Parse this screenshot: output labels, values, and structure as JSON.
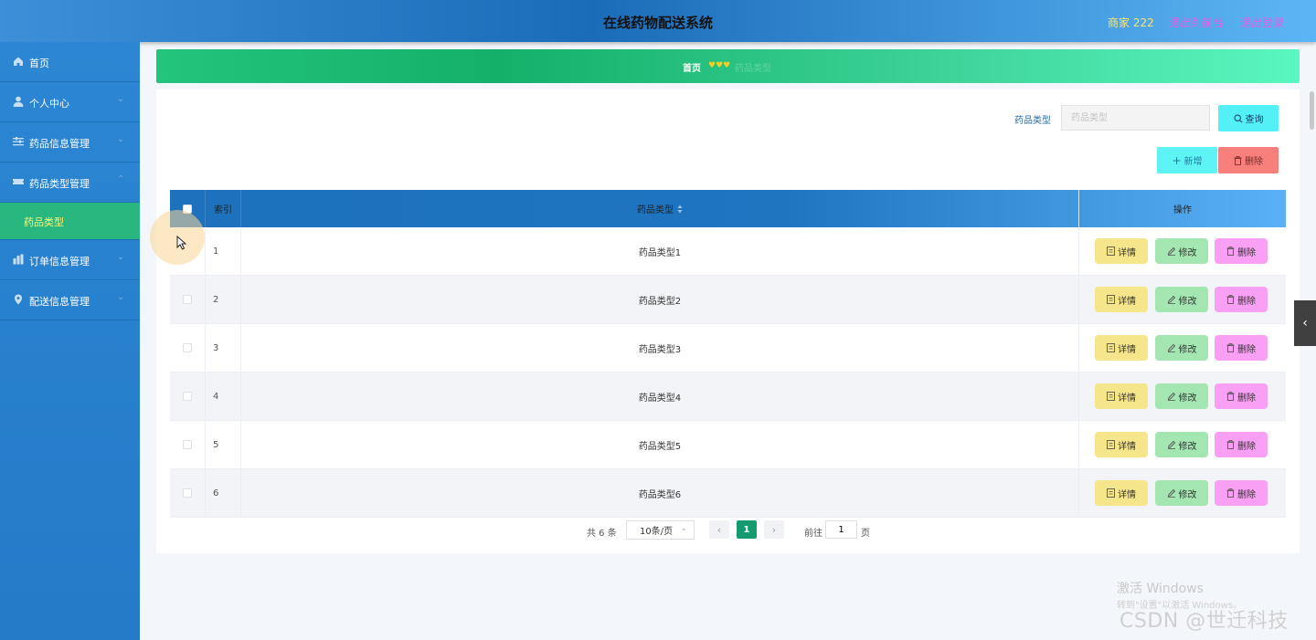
{
  "header": {
    "title": "在线药物配送系统",
    "user": "商家 222",
    "back_link": "退出到前台",
    "logout_link": "退出登录"
  },
  "sidebar": {
    "items": [
      {
        "label": "首页",
        "icon": "home-icon"
      },
      {
        "label": "个人中心",
        "icon": "user-icon"
      },
      {
        "label": "药品信息管理",
        "icon": "sliders-icon"
      },
      {
        "label": "药品类型管理",
        "icon": "ticket-icon"
      },
      {
        "label": "订单信息管理",
        "icon": "chart-icon"
      },
      {
        "label": "配送信息管理",
        "icon": "location-icon"
      }
    ],
    "active_sub": "药品类型"
  },
  "breadcrumb": {
    "home": "首页",
    "separator": "♥♥♥",
    "current": "药品类型"
  },
  "search": {
    "label": "药品类型",
    "placeholder": "药品类型",
    "query_button": "查询"
  },
  "toolbar": {
    "add_label": "新增",
    "delete_label": "删除"
  },
  "table": {
    "columns": [
      "索引",
      "药品类型",
      "操作"
    ],
    "rows": [
      {
        "index": "1",
        "type": "药品类型1"
      },
      {
        "index": "2",
        "type": "药品类型2"
      },
      {
        "index": "3",
        "type": "药品类型3"
      },
      {
        "index": "4",
        "type": "药品类型4"
      },
      {
        "index": "5",
        "type": "药品类型5"
      },
      {
        "index": "6",
        "type": "药品类型6"
      }
    ],
    "actions": {
      "detail": "详情",
      "edit": "修改",
      "remove": "删除"
    }
  },
  "pagination": {
    "total": "共 6 条",
    "page_size": "10条/页",
    "current_page": "1",
    "goto_label": "前往",
    "goto_value": "1",
    "page_suffix": "页"
  },
  "watermark": {
    "activate_title": "激活 Windows",
    "activate_hint": "转到\"设置\"以激活 Windows。",
    "csdn": "CSDN @世迁科技"
  },
  "colors": {
    "accent_green": "#129a70",
    "sidebar_blue": "#2c86d3",
    "submenu_green": "#29b77f"
  }
}
